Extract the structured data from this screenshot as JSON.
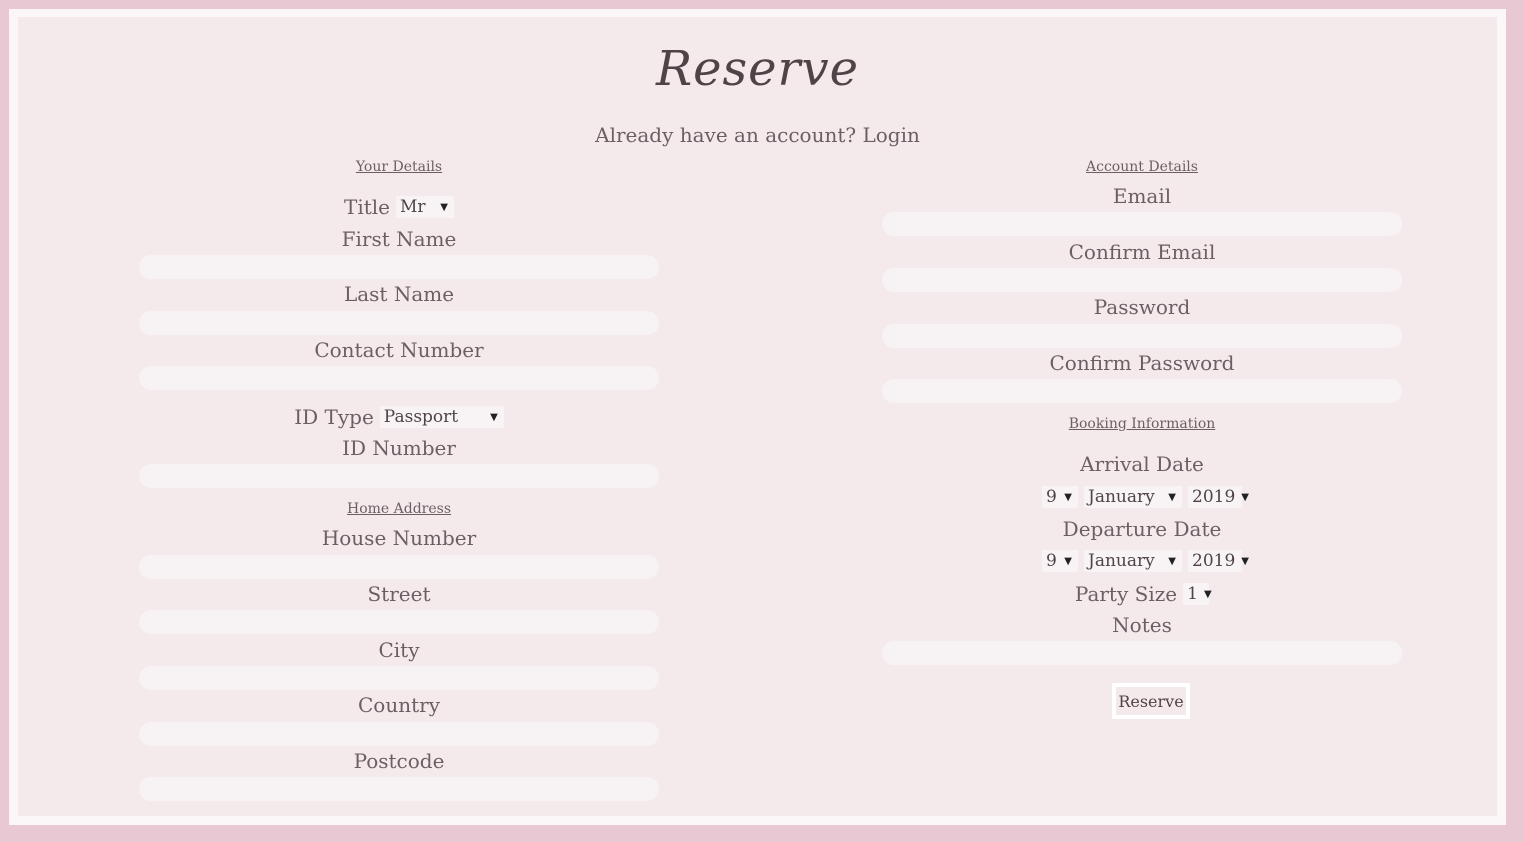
{
  "header": {
    "title": "Reserve",
    "login_prompt": "Already have an account? Login"
  },
  "your_details": {
    "section_title": "Your Details",
    "title_label": "Title",
    "title_value": "Mr",
    "first_name_label": "First Name",
    "last_name_label": "Last Name",
    "contact_label": "Contact Number",
    "id_type_label": "ID Type",
    "id_type_value": "Passport",
    "id_number_label": "ID Number"
  },
  "home_address": {
    "section_title": "Home Address",
    "house_label": "House Number",
    "street_label": "Street",
    "city_label": "City",
    "country_label": "Country",
    "postcode_label": "Postcode"
  },
  "account_details": {
    "section_title": "Account Details",
    "email_label": "Email",
    "confirm_email_label": "Confirm Email",
    "password_label": "Password",
    "confirm_password_label": "Confirm Password"
  },
  "booking": {
    "section_title": "Booking Information",
    "arrival_label": "Arrival Date",
    "arrival_day": "9",
    "arrival_month": "January",
    "arrival_year": "2019",
    "departure_label": "Departure Date",
    "departure_day": "9",
    "departure_month": "January",
    "departure_year": "2019",
    "party_label": "Party Size",
    "party_value": "1",
    "notes_label": "Notes",
    "submit_label": "Reserve"
  },
  "colors": {
    "outer_border": "#e8c8d3",
    "panel_bg": "#f4eaec",
    "input_bg": "#f7f3f4"
  }
}
